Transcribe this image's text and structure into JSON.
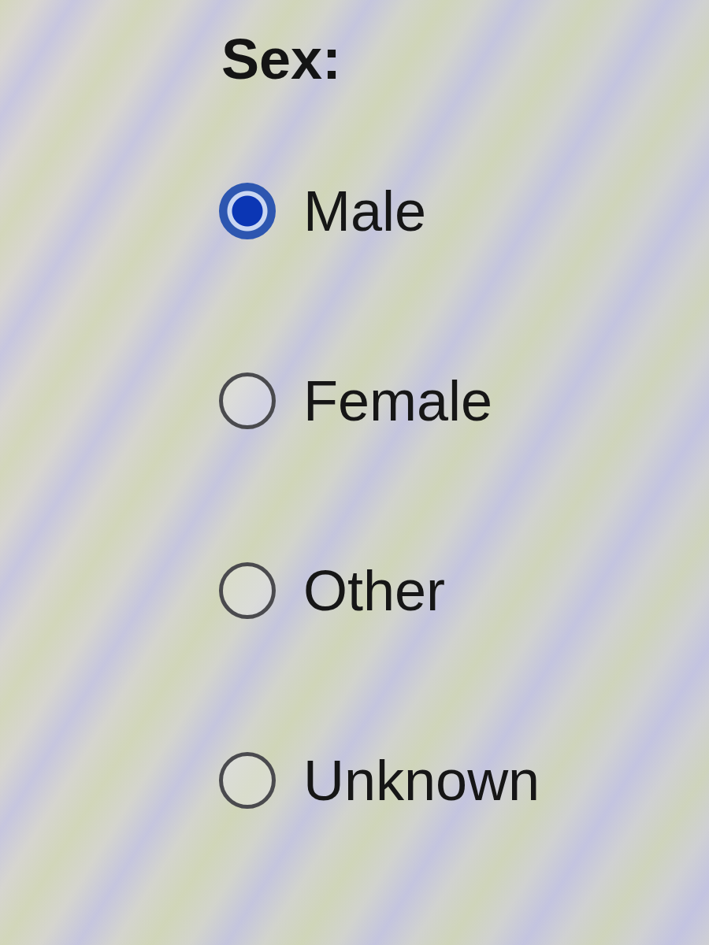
{
  "sex_field": {
    "label": "Sex:",
    "options": [
      {
        "label": "Male",
        "selected": true
      },
      {
        "label": "Female",
        "selected": false
      },
      {
        "label": "Other",
        "selected": false
      },
      {
        "label": "Unknown",
        "selected": false
      }
    ]
  }
}
